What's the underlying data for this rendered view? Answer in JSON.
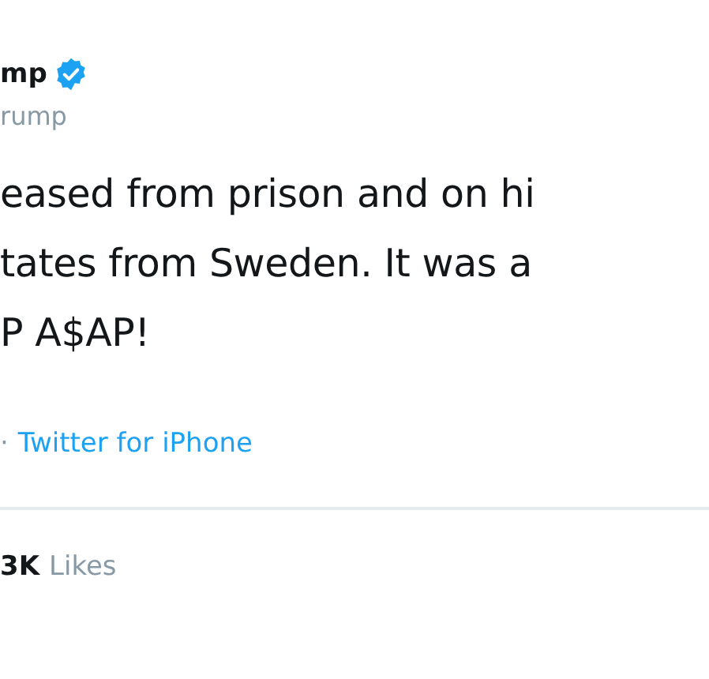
{
  "author": {
    "name": "mp",
    "verified": true,
    "handle": "rump"
  },
  "tweet": {
    "lines": [
      "eased from prison and on hi",
      "tates from Sweden. It was a",
      "P A$AP!"
    ]
  },
  "source": {
    "separator": "·",
    "app": "Twitter for iPhone"
  },
  "stats": {
    "likes_count": "3K",
    "likes_label": "Likes"
  }
}
